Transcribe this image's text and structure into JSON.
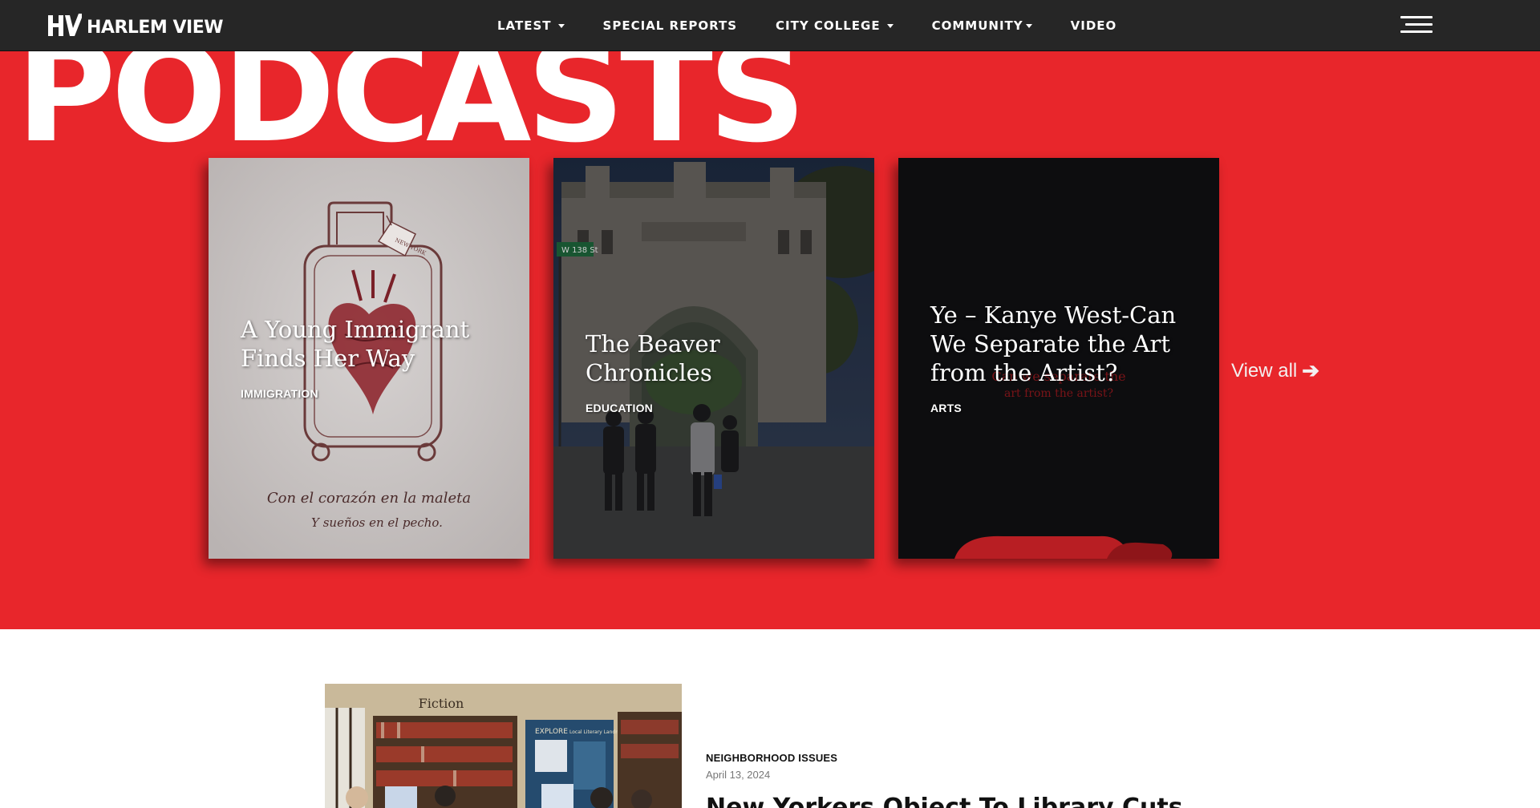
{
  "nav": {
    "brand": "HARLEM VIEW",
    "items": [
      {
        "label": "LATEST",
        "dropdown": true
      },
      {
        "label": "SPECIAL REPORTS",
        "dropdown": false
      },
      {
        "label": "CITY COLLEGE",
        "dropdown": true
      },
      {
        "label": "COMMUNITY",
        "dropdown": true
      },
      {
        "label": "VIDEO",
        "dropdown": false
      }
    ],
    "menu_icon": "hamburger-menu-icon"
  },
  "podcasts": {
    "section_title": "PODCASTS",
    "cards": [
      {
        "title": "A Young Immigrant Finds Her Way",
        "tag": "IMMIGRATION",
        "image_caption_line1": "Con el corazón en la maleta",
        "image_caption_line2": "Y sueños en el pecho.",
        "tag_on_luggage": "NEW YORK"
      },
      {
        "title": "The Beaver Chronicles",
        "tag": "EDUCATION",
        "street_sign": "W 138 St"
      },
      {
        "title": "Ye – Kanye West-Can We Separate the Art from the Artist?",
        "tag": "ARTS",
        "bg_text_line1": "Can we separate the",
        "bg_text_line2": "art from the artist?"
      }
    ],
    "view_all_label": "View all"
  },
  "article": {
    "category": "NEIGHBORHOOD ISSUES",
    "date": "April 13, 2024",
    "title": "New Yorkers Object To Library Cuts",
    "image_labels": {
      "sign_fiction": "Fiction",
      "sign_explore": "EXPLORE",
      "sign_landmarks": "Local Literary Landmarks"
    }
  },
  "colors": {
    "nav_bg": "#262626",
    "hero_red": "#e8262b",
    "white": "#ffffff"
  }
}
